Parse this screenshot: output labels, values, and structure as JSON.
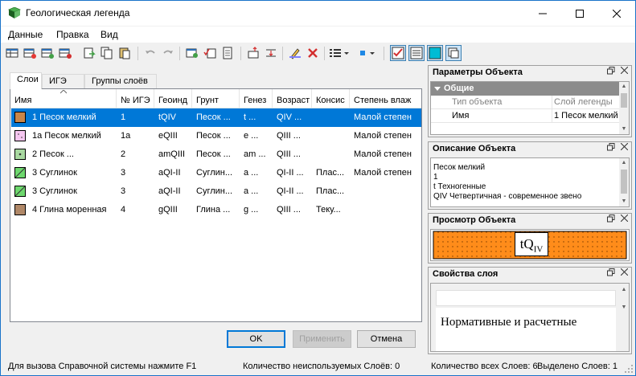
{
  "window": {
    "title": "Геологическая легенда"
  },
  "menu": [
    "Данные",
    "Правка",
    "Вид"
  ],
  "tabs": [
    "Слои",
    "ИГЭ",
    "Группы слоёв"
  ],
  "grid": {
    "columns": [
      "Имя",
      "№ ИГЭ",
      "Геоинд",
      "Грунт",
      "Генез",
      "Возраст",
      "Консис",
      "Степень влаж"
    ],
    "rows": [
      {
        "name": "1 Песок мелкий",
        "ige": "1",
        "geoind": "tQIV",
        "soil": "Песок ...",
        "genesis": "t ...",
        "age": "QIV ...",
        "consist": "",
        "moisture": "Малой степен",
        "swatch": "#c8864a",
        "selected": true
      },
      {
        "name": "1а Песок мелкий",
        "ige": "1а",
        "geoind": "eQIII",
        "soil": "Песок ...",
        "genesis": "e ...",
        "age": "QIII ...",
        "consist": "",
        "moisture": "Малой степен",
        "swatch": "#f5c6f0",
        "selected": false
      },
      {
        "name": "2 Песок ...",
        "ige": "2",
        "geoind": "amQIII",
        "soil": "Песок ...",
        "genesis": "am ...",
        "age": "QIII ...",
        "consist": "",
        "moisture": "Малой степен",
        "swatch": "#a8d8a0",
        "selected": false
      },
      {
        "name": "3 Суглинок",
        "ige": "3",
        "geoind": "aQI-II",
        "soil": "Суглин...",
        "genesis": "a ...",
        "age": "QI-II ...",
        "consist": "Плас...",
        "moisture": "Малой степен",
        "swatch": "#6ed86e",
        "selected": false
      },
      {
        "name": "3 Суглинок",
        "ige": "3",
        "geoind": "aQI-II",
        "soil": "Суглин...",
        "genesis": "a ...",
        "age": "QI-II ...",
        "consist": "Плас...",
        "moisture": "",
        "swatch": "#6ed86e",
        "selected": false
      },
      {
        "name": "4 Глина моренная",
        "ige": "4",
        "geoind": "gQIII",
        "soil": "Глина ...",
        "genesis": "g ...",
        "age": "QIII ...",
        "consist": "Теку...",
        "moisture": "",
        "swatch": "#b08868",
        "selected": false
      }
    ]
  },
  "buttons": {
    "ok": "OK",
    "apply": "Применить",
    "cancel": "Отмена"
  },
  "status": {
    "help": "Для вызова Справочной системы нажмите F1",
    "unused": "Количество неиспользуемых Слоёв: 0",
    "total": "Количество всех Слоев: 6",
    "selected": "Выделено Слоев: 1"
  },
  "params_panel": {
    "title": "Параметры Объекта",
    "group": "Общие",
    "header_key": "Тип объекта",
    "header_val": "Слой легенды",
    "row_key": "Имя",
    "row_val": "1 Песок мелкий"
  },
  "desc_panel": {
    "title": "Описание Объекта",
    "lines": [
      "Песок мелкий",
      "1",
      "t Техногенные",
      "QIV Четвертичная - современное звено"
    ]
  },
  "preview_panel": {
    "title": "Просмотр Объекта",
    "label_main": "tQ",
    "label_sub": "IV",
    "fill": "#ff8c1a"
  },
  "props_panel": {
    "title": "Свойства слоя",
    "text": "Нормативные и расчетные"
  },
  "colors": {
    "accent": "#0078d7",
    "selected_row": "#0078d7"
  }
}
